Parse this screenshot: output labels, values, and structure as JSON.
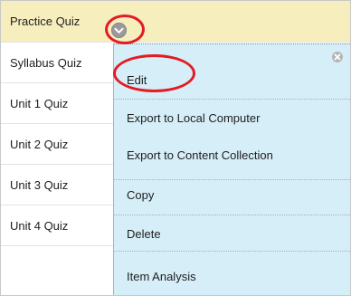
{
  "quizzes": [
    {
      "label": "Practice Quiz"
    },
    {
      "label": "Syllabus Quiz"
    },
    {
      "label": "Unit 1 Quiz"
    },
    {
      "label": "Unit 2 Quiz"
    },
    {
      "label": "Unit 3 Quiz"
    },
    {
      "label": "Unit 4 Quiz"
    },
    {
      "label": ""
    }
  ],
  "menu": {
    "items": [
      {
        "label": "Edit"
      },
      {
        "label": "Export to Local Computer"
      },
      {
        "label": "Export to Content Collection"
      },
      {
        "label": "Copy"
      },
      {
        "label": "Delete"
      },
      {
        "label": "Item Analysis"
      }
    ]
  },
  "colors": {
    "active_row": "#f7eebe",
    "menu_background": "#d6eef8",
    "highlight": "#e31b23"
  },
  "icons": {
    "row_menu": "chevron-down-icon",
    "menu_close": "close-icon"
  }
}
